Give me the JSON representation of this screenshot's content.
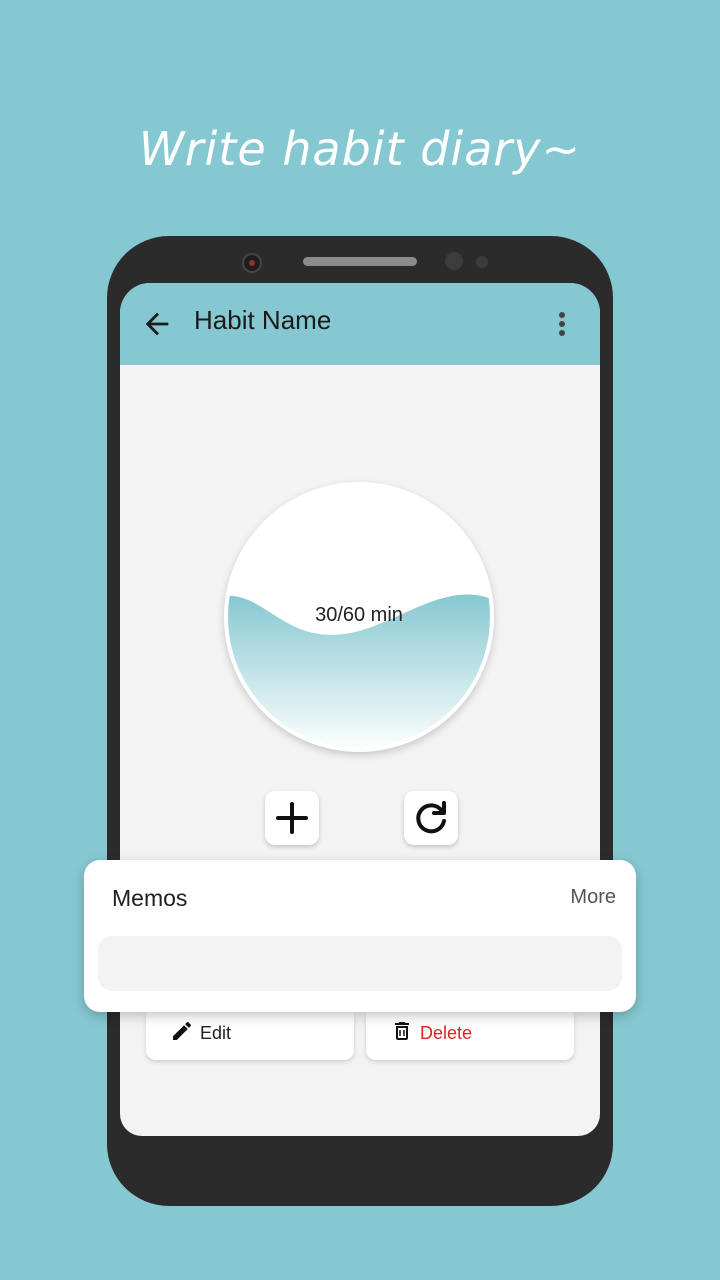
{
  "headline": "Write habit diary~",
  "app_bar": {
    "title": "Habit Name",
    "background": "#86c8d1",
    "back_icon": "arrow-left-icon",
    "menu_icon": "more-vertical-icon"
  },
  "progress": {
    "label": "30/60 min",
    "current": 30,
    "goal": 60,
    "fill_fraction": 0.5,
    "fill_color": "#86c8d1"
  },
  "controls": {
    "add_icon": "plus-icon",
    "reset_icon": "refresh-icon"
  },
  "actions": {
    "edit_label": "Edit",
    "edit_icon": "pencil-icon",
    "delete_label": "Delete",
    "delete_icon": "trash-icon",
    "delete_color": "#e02020"
  },
  "memos": {
    "title": "Memos",
    "more_label": "More",
    "items": []
  }
}
